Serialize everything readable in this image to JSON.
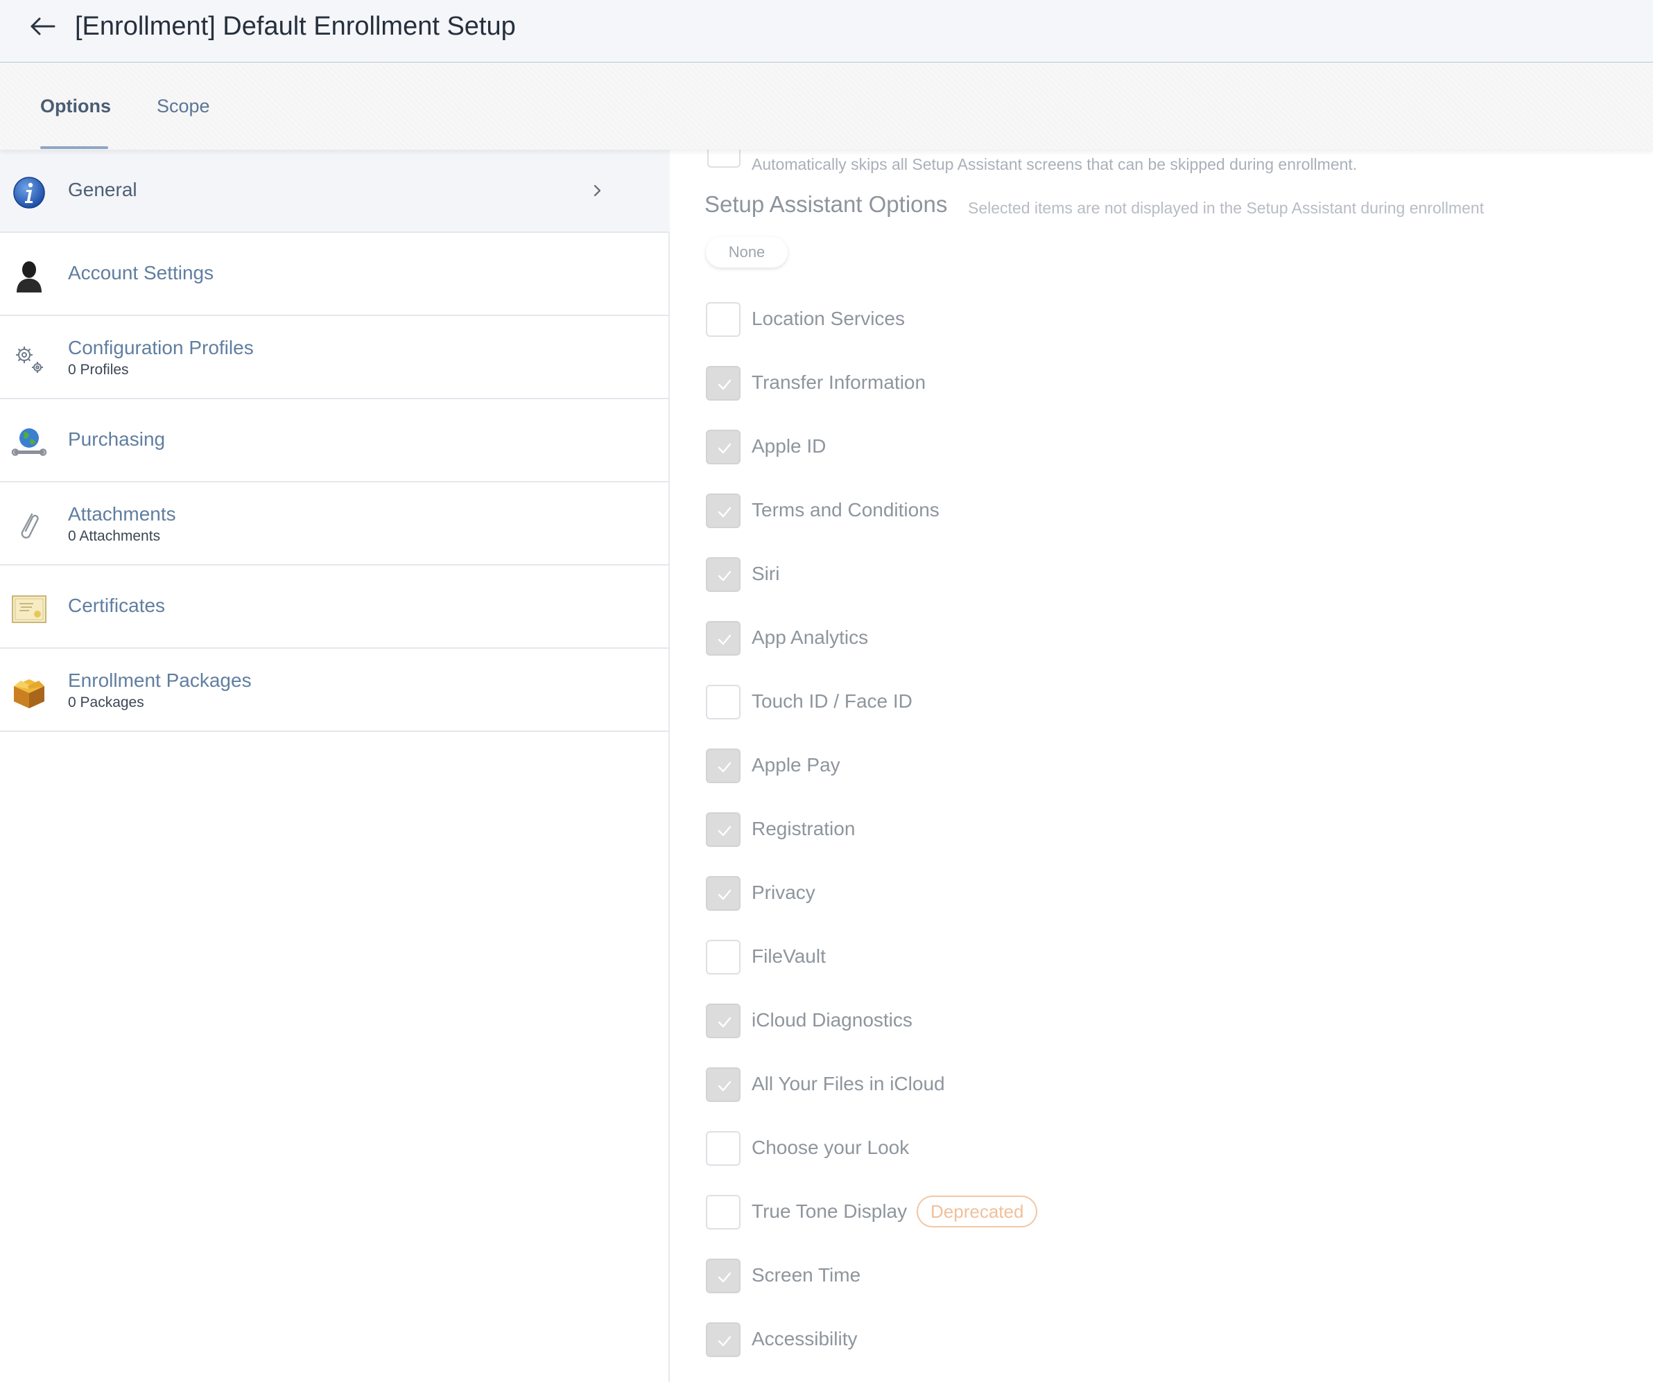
{
  "header": {
    "title": "[Enrollment] Default Enrollment Setup"
  },
  "tabs": [
    {
      "label": "Options",
      "active": true
    },
    {
      "label": "Scope",
      "active": false
    }
  ],
  "sidebar": {
    "items": [
      {
        "label": "General",
        "sub": "",
        "icon": "info-icon",
        "selected": true
      },
      {
        "label": "Account Settings",
        "sub": "",
        "icon": "user-silhouette-icon",
        "selected": false
      },
      {
        "label": "Configuration Profiles",
        "sub": "0 Profiles",
        "icon": "gears-icon",
        "selected": false
      },
      {
        "label": "Purchasing",
        "sub": "",
        "icon": "globe-wrench-icon",
        "selected": false
      },
      {
        "label": "Attachments",
        "sub": "0 Attachments",
        "icon": "paperclip-icon",
        "selected": false
      },
      {
        "label": "Certificates",
        "sub": "",
        "icon": "certificate-icon",
        "selected": false
      },
      {
        "label": "Enrollment Packages",
        "sub": "0 Packages",
        "icon": "package-box-icon",
        "selected": false
      }
    ]
  },
  "main": {
    "top_description": "Automatically skips all Setup Assistant screens that can be skipped during enrollment.",
    "section_title": "Setup Assistant Options",
    "section_hint": "Selected items are not displayed in the Setup Assistant during enrollment",
    "none_button": "None",
    "options": [
      {
        "label": "Location Services",
        "checked": false
      },
      {
        "label": "Transfer Information",
        "checked": true
      },
      {
        "label": "Apple ID",
        "checked": true
      },
      {
        "label": "Terms and Conditions",
        "checked": true
      },
      {
        "label": "Siri",
        "checked": true
      },
      {
        "label": "App Analytics",
        "checked": true
      },
      {
        "label": "Touch ID / Face ID",
        "checked": false
      },
      {
        "label": "Apple Pay",
        "checked": true
      },
      {
        "label": "Registration",
        "checked": true
      },
      {
        "label": "Privacy",
        "checked": true
      },
      {
        "label": "FileVault",
        "checked": false
      },
      {
        "label": "iCloud Diagnostics",
        "checked": true
      },
      {
        "label": "All Your Files in iCloud",
        "checked": true
      },
      {
        "label": "Choose your Look",
        "checked": false
      },
      {
        "label": "True Tone Display",
        "checked": false,
        "badge": "Deprecated"
      },
      {
        "label": "Screen Time",
        "checked": true
      },
      {
        "label": "Accessibility",
        "checked": true
      }
    ]
  },
  "colors": {
    "header_bg": "#f4f6f9",
    "link_blue": "#607ea0",
    "checkbox_checked": "#dcdcdc",
    "badge_orange": "#f1c09a"
  }
}
